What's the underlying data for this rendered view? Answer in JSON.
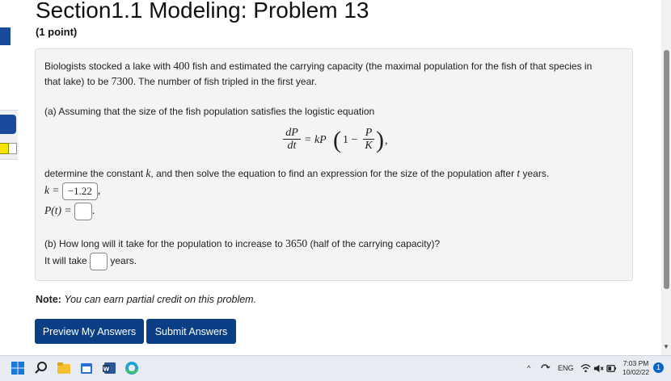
{
  "header": {
    "title": "Section1.1 Modeling: Problem 13",
    "points": "(1 point)"
  },
  "problem": {
    "intro_pre": "Biologists stocked a lake with ",
    "initial_fish": "400",
    "intro_mid": " fish and estimated the carrying capacity (the maximal population for the fish of that species in",
    "intro_line2_pre": "that lake) to be ",
    "carrying_capacity": "7300",
    "intro_line2_post": ". The number of fish tripled in the first year.",
    "part_a": "(a) Assuming that the size of the fish population satisfies the logistic equation",
    "equation": {
      "lhs_num": "dP",
      "lhs_den": "dt",
      "equals_kP": "= kP",
      "one_minus": "1 −",
      "inner_num": "P",
      "inner_den": "K",
      "trail": ","
    },
    "determine_pre": "determine the constant ",
    "determine_k": "k",
    "determine_mid": ", and then solve the equation to find an expression for the size of the population after ",
    "determine_t": "t",
    "determine_post": " years.",
    "k_label": "k =",
    "k_value": "−1.22",
    "k_trail": ",",
    "pt_label": "P(t) =",
    "pt_value": "",
    "pt_trail": ".",
    "part_b_pre": "(b) How long will it take for the population to increase to ",
    "part_b_num": "3650",
    "part_b_post": " (half of the carrying capacity)?",
    "it_will_take": "It will take",
    "years_value": "",
    "years_label": "years."
  },
  "note": {
    "label": "Note:",
    "text": "You can earn partial credit on this problem."
  },
  "buttons": {
    "preview": "Preview My Answers",
    "submit": "Submit Answers"
  },
  "taskbar": {
    "language": "ENG",
    "time": "7:03 PM",
    "date": "10/02/22",
    "notification_count": "1"
  },
  "colors": {
    "button_bg": "#0b3f85",
    "box_bg": "#f4f4f4",
    "accent": "#1a4a9a"
  }
}
